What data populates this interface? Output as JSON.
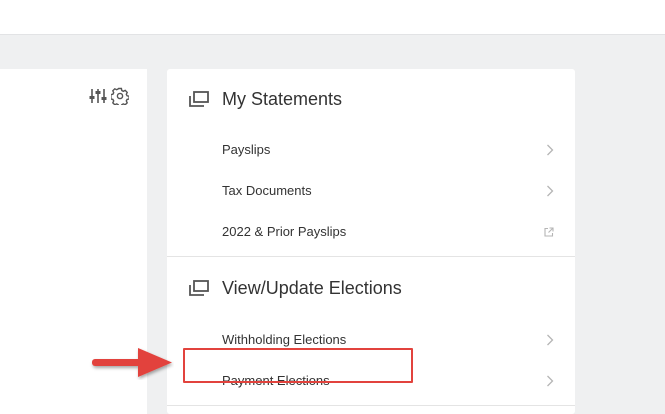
{
  "statements": {
    "title": "My Statements",
    "items": [
      {
        "label": "Payslips",
        "icon": "chevron-right-icon"
      },
      {
        "label": "Tax Documents",
        "icon": "chevron-right-icon"
      },
      {
        "label": "2022 & Prior Payslips",
        "icon": "external-link-icon"
      }
    ]
  },
  "elections": {
    "title": "View/Update Elections",
    "items": [
      {
        "label": "Withholding Elections",
        "icon": "chevron-right-icon"
      },
      {
        "label": "Payment Elections",
        "icon": "chevron-right-icon"
      }
    ]
  },
  "colors": {
    "background": "#eff0f1",
    "panel": "#ffffff",
    "highlight": "#e2433d",
    "icon": "#555555",
    "chevron": "#b5b5b5"
  }
}
